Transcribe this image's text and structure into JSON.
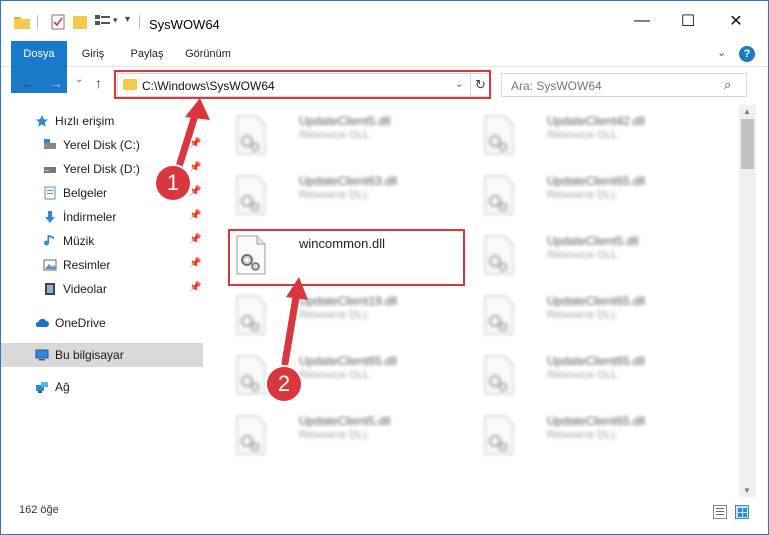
{
  "window": {
    "title": "SysWOW64",
    "minimize": "—",
    "maximize": "☐",
    "close": "✕"
  },
  "ribbon": {
    "tabs": [
      "Dosya",
      "Giriş",
      "Paylaş",
      "Görünüm"
    ],
    "expand": "⌄",
    "help": "?"
  },
  "nav": {
    "back": "←",
    "forward": "→",
    "recent": "⌄",
    "up": "↑",
    "address": "C:\\Windows\\SysWOW64",
    "address_dropdown": "⌄",
    "refresh": "↻",
    "search_placeholder": "Ara: SysWOW64",
    "search_icon": "⌕"
  },
  "sidebar": {
    "items": [
      {
        "label": "Hızlı erişim",
        "icon": "star-icon",
        "pinned": false
      },
      {
        "label": "Yerel Disk (C:)",
        "icon": "drive-icon",
        "pinned": true
      },
      {
        "label": "Yerel Disk (D:)",
        "icon": "drive-icon",
        "pinned": true
      },
      {
        "label": "Belgeler",
        "icon": "documents-icon",
        "pinned": true
      },
      {
        "label": "İndirmeler",
        "icon": "download-icon",
        "pinned": true
      },
      {
        "label": "Müzik",
        "icon": "music-icon",
        "pinned": true
      },
      {
        "label": "Resimler",
        "icon": "pictures-icon",
        "pinned": true
      },
      {
        "label": "Videolar",
        "icon": "videos-icon",
        "pinned": true
      },
      {
        "label": "OneDrive",
        "icon": "cloud-icon",
        "pinned": false
      },
      {
        "label": "Bu bilgisayar",
        "icon": "computer-icon",
        "pinned": false
      },
      {
        "label": "Ağ",
        "icon": "network-icon",
        "pinned": false
      }
    ],
    "pin_glyph": "📌"
  },
  "files": [
    {
      "name": "UpdateClient5.dll",
      "desc": "Resource DLL"
    },
    {
      "name": "UpdateClient42.dll",
      "desc": "Resource DLL"
    },
    {
      "name": "UpdateClient63.dll",
      "desc": "Resource DLL"
    },
    {
      "name": "UpdateClient65.dll",
      "desc": "Resource DLL"
    },
    {
      "name": "wincommon.dll",
      "desc": ""
    },
    {
      "name": "UpdateClient5.dll",
      "desc": "Resource DLL"
    },
    {
      "name": "UpdateClient19.dll",
      "desc": "Resource DLL"
    },
    {
      "name": "UpdateClient65.dll",
      "desc": "Resource DLL"
    },
    {
      "name": "UpdateClient65.dll",
      "desc": "Resource DLL"
    },
    {
      "name": "UpdateClient65.dll",
      "desc": "Resource DLL"
    },
    {
      "name": "UpdateClient5.dll",
      "desc": "Resource DLL"
    },
    {
      "name": "UpdateClient65.dll",
      "desc": "Resource DLL"
    }
  ],
  "status": {
    "count": "162 öğe"
  },
  "callouts": [
    "1",
    "2"
  ],
  "colors": {
    "accent": "#1979ca",
    "highlight": "#d9363e",
    "selected": "#d9d9d9"
  }
}
